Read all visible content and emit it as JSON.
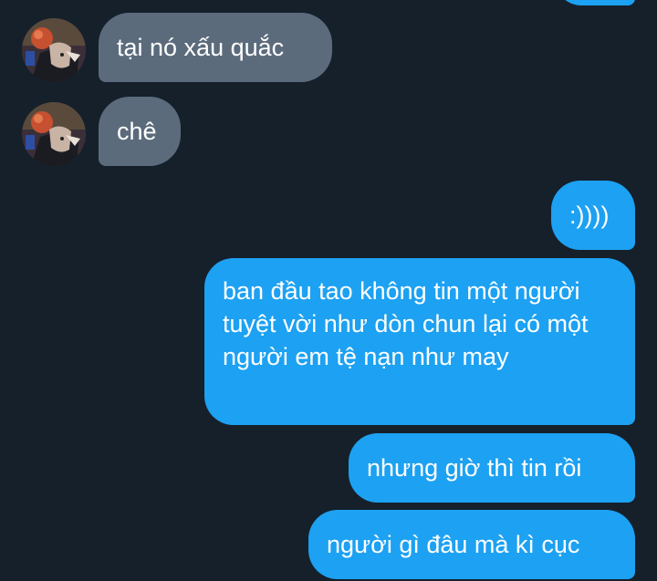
{
  "conversation": {
    "messages": [
      {
        "side": "incoming",
        "text": "tại nó xấu quắc"
      },
      {
        "side": "incoming",
        "text": "chê"
      },
      {
        "side": "outgoing",
        "text": ":))))"
      },
      {
        "side": "outgoing",
        "text": "ban đầu tao không tin một người tuyệt vời như dòn chun lại có một người em tệ nạn như may"
      },
      {
        "side": "outgoing",
        "text": "nhưng giờ thì tin rồi"
      },
      {
        "side": "outgoing",
        "text": "người gì đâu mà kì cục"
      }
    ],
    "avatar_icon": "user-avatar-illustration",
    "colors": {
      "background": "#15202b",
      "incoming_bubble": "#5b6b7c",
      "outgoing_bubble": "#1da1f2",
      "text": "#ffffff"
    }
  }
}
